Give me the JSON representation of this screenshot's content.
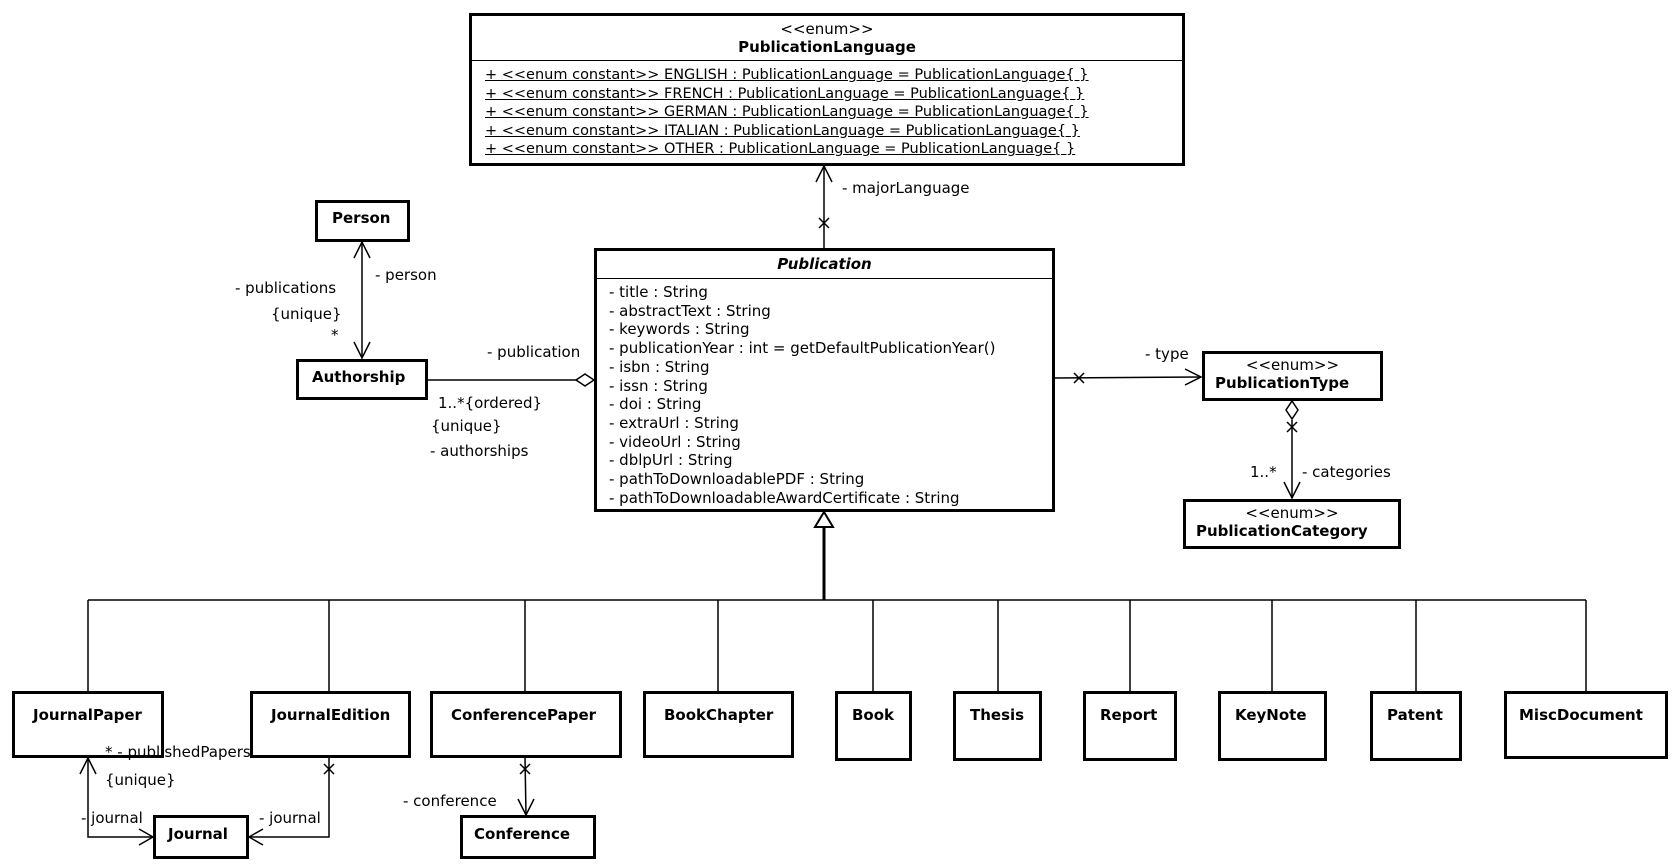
{
  "classes": {
    "publication_language": {
      "stereotype": "<<enum>>",
      "name": "PublicationLanguage",
      "constants": [
        "+ <<enum constant>> ENGLISH : PublicationLanguage = PublicationLanguage{ }",
        "+ <<enum constant>> FRENCH : PublicationLanguage = PublicationLanguage{ }",
        "+ <<enum constant>> GERMAN : PublicationLanguage = PublicationLanguage{ }",
        "+ <<enum constant>> ITALIAN : PublicationLanguage = PublicationLanguage{ }",
        "+ <<enum constant>> OTHER : PublicationLanguage = PublicationLanguage{ }"
      ]
    },
    "publication": {
      "name": "Publication",
      "abstract": true,
      "attributes": [
        "- title : String",
        "- abstractText : String",
        "- keywords : String",
        "- publicationYear : int = getDefaultPublicationYear()",
        "- isbn : String",
        "- issn : String",
        "- doi : String",
        "- extraUrl : String",
        "- videoUrl : String",
        "- dblpUrl : String",
        "- pathToDownloadablePDF : String",
        "- pathToDownloadableAwardCertificate : String"
      ]
    },
    "person": {
      "name": "Person"
    },
    "authorship": {
      "name": "Authorship"
    },
    "publication_type": {
      "stereotype": "<<enum>>",
      "name": "PublicationType"
    },
    "publication_category": {
      "stereotype": "<<enum>>",
      "name": "PublicationCategory"
    },
    "journal": {
      "name": "Journal"
    },
    "conference": {
      "name": "Conference"
    },
    "subclasses": [
      {
        "name": "JournalPaper"
      },
      {
        "name": "JournalEdition"
      },
      {
        "name": "ConferencePaper"
      },
      {
        "name": "BookChapter"
      },
      {
        "name": "Book"
      },
      {
        "name": "Thesis"
      },
      {
        "name": "Report"
      },
      {
        "name": "KeyNote"
      },
      {
        "name": "Patent"
      },
      {
        "name": "MiscDocument"
      }
    ]
  },
  "labels": {
    "major_language": "- majorLanguage",
    "person_role": "- person",
    "publications_role": "- publications",
    "publications_unique": "{unique}",
    "publications_mult": "*",
    "publication_role": "- publication",
    "authorships_mult": "1..*{ordered}",
    "authorships_unique": "{unique}",
    "authorships_role": "- authorships",
    "type_role": "- type",
    "categories_mult": "1..*",
    "categories_role": "- categories",
    "published_papers": "* - publishedPapers",
    "published_papers_unique": "{unique}",
    "journal_role_left": "- journal",
    "journal_role_right": "- journal",
    "conference_role": "- conference"
  }
}
